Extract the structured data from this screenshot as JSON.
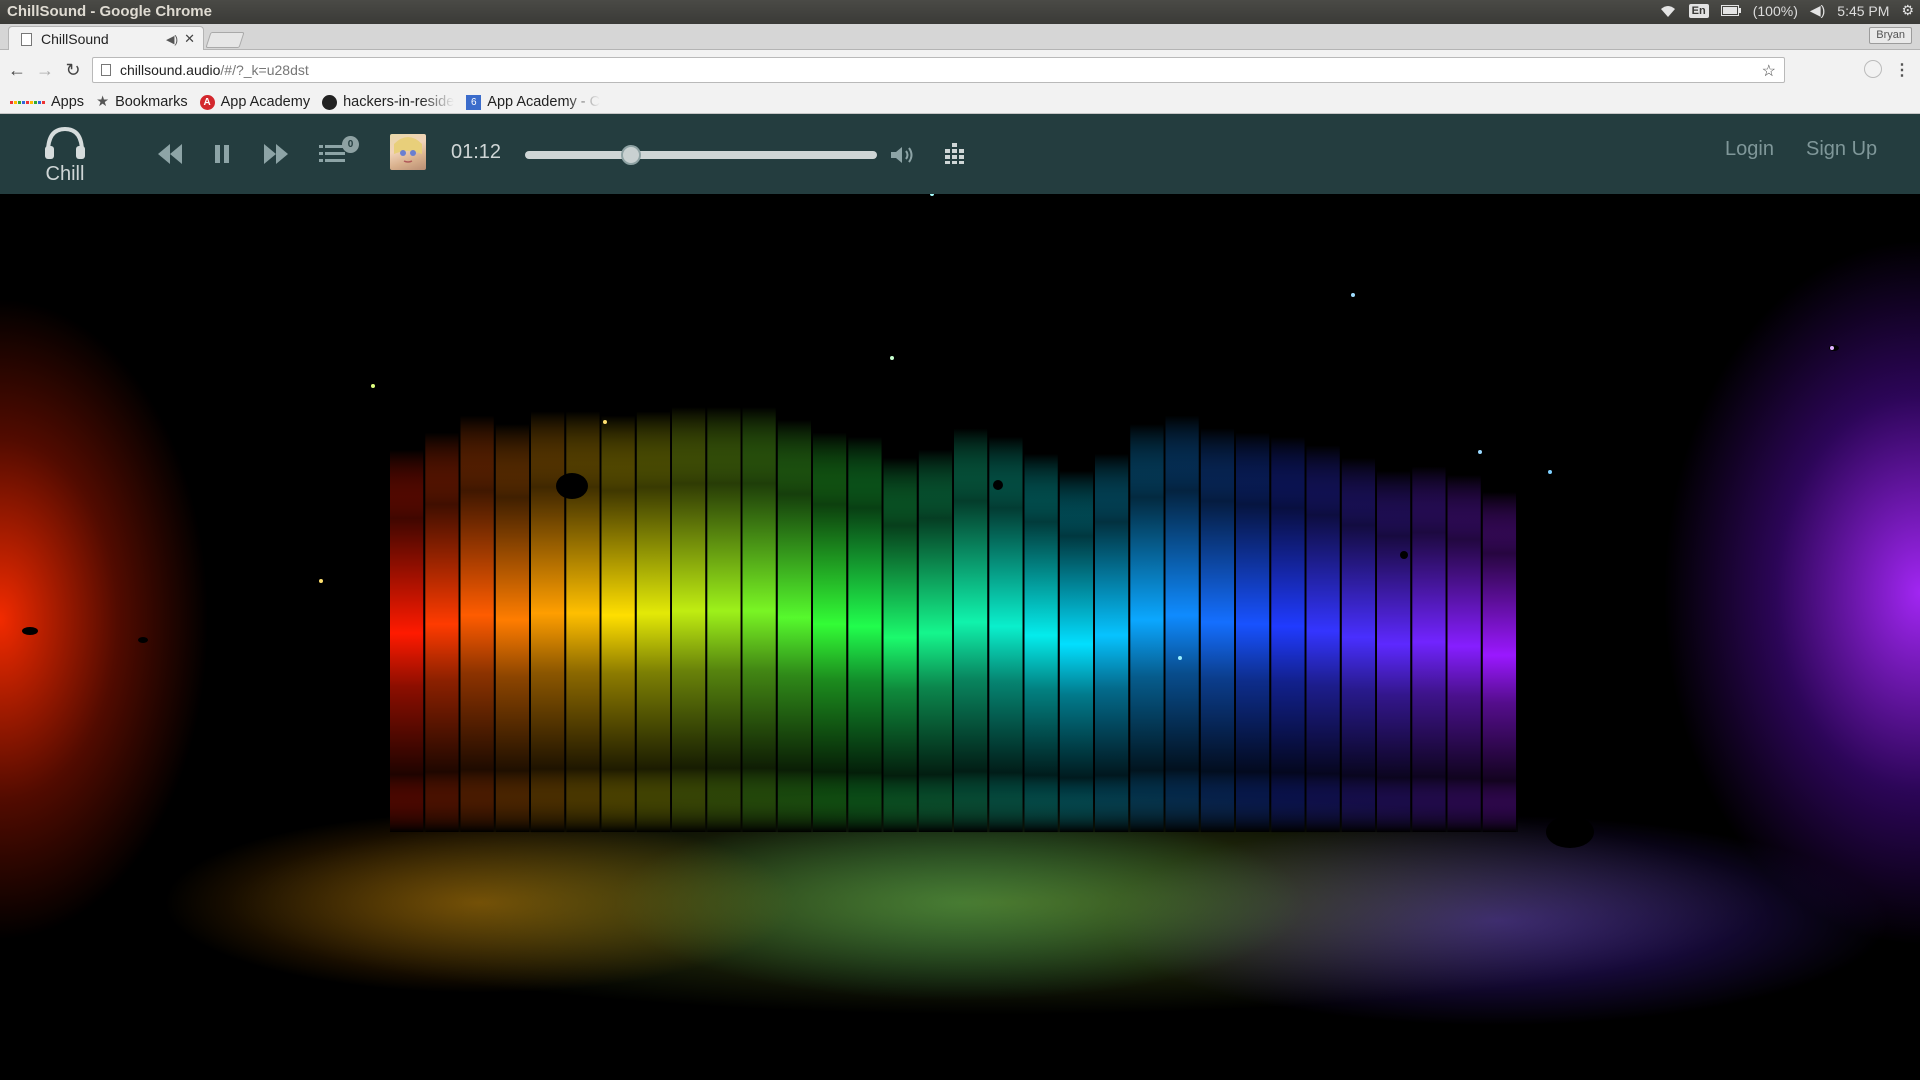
{
  "os": {
    "window_title": "ChillSound - Google Chrome",
    "lang": "En",
    "battery": "(100%)",
    "clock": "5:45 PM"
  },
  "browser": {
    "tab_title": "ChillSound",
    "profile": "Bryan",
    "url_host": "chillsound.audio",
    "url_path": "/#/?_k=u28dst",
    "bookmarks": [
      {
        "label": "Apps",
        "icon": "apps-grid-icon"
      },
      {
        "label": "Bookmarks",
        "icon": "star-icon"
      },
      {
        "label": "App Academy",
        "icon": "app-academy-icon"
      },
      {
        "label": "hackers-in-reside",
        "icon": "github-icon"
      },
      {
        "label": "App Academy - C",
        "icon": "google-sites-icon"
      }
    ]
  },
  "player": {
    "logo_label": "Chill",
    "queue_count": "0",
    "time": "01:12",
    "progress": 0.3,
    "login": "Login",
    "signup": "Sign Up"
  },
  "visualizer": {
    "bar_levels": [
      0.9,
      0.94,
      0.98,
      0.96,
      0.99,
      0.99,
      0.98,
      0.99,
      1.0,
      1.0,
      1.0,
      0.97,
      0.94,
      0.93,
      0.88,
      0.9,
      0.95,
      0.93,
      0.89,
      0.85,
      0.89,
      0.96,
      0.98,
      0.95,
      0.94,
      0.93,
      0.91,
      0.88,
      0.85,
      0.86,
      0.84,
      0.8
    ],
    "colors": [
      "#ff1a00",
      "#ffe600",
      "#25ff3a",
      "#00eaff",
      "#1c3cff",
      "#9a18ff"
    ]
  }
}
